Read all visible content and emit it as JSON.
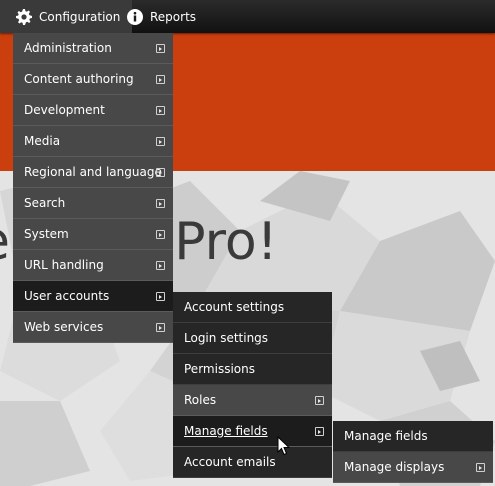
{
  "toolbar": {
    "configuration_label": "Configuration",
    "reports_label": "Reports"
  },
  "hero": {
    "text": "e        ePro!"
  },
  "menu_configuration": [
    {
      "label": "Administration"
    },
    {
      "label": "Content authoring"
    },
    {
      "label": "Development"
    },
    {
      "label": "Media"
    },
    {
      "label": "Regional and language"
    },
    {
      "label": "Search"
    },
    {
      "label": "System"
    },
    {
      "label": "URL handling"
    },
    {
      "label": "User accounts"
    },
    {
      "label": "Web services"
    }
  ],
  "menu_user_accounts": [
    {
      "label": "Account settings"
    },
    {
      "label": "Login settings"
    },
    {
      "label": "Permissions"
    },
    {
      "label": "Roles"
    },
    {
      "label": "Manage fields"
    },
    {
      "label": "Account emails"
    }
  ],
  "menu_manage_fields": [
    {
      "label": "Manage fields"
    },
    {
      "label": "Manage displays"
    }
  ],
  "colors": {
    "banner": "#cb3e0e",
    "toolbar": "#1e1e1e",
    "menu_item": "#484848",
    "menu_item_dark": "#262626"
  }
}
